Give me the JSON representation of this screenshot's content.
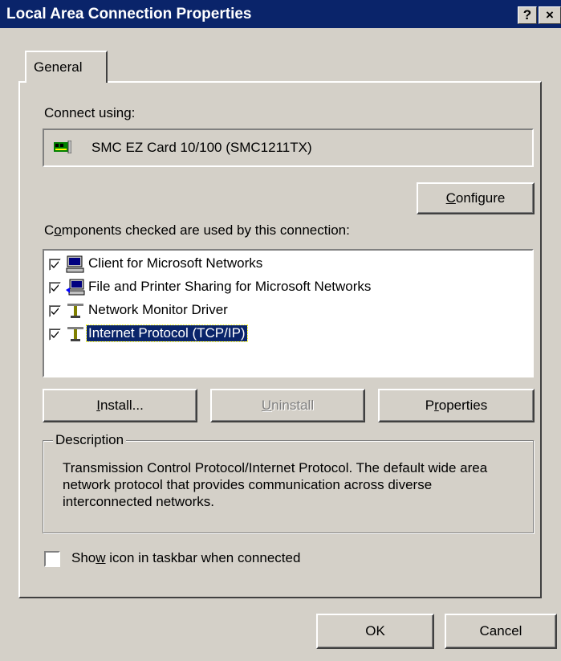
{
  "window": {
    "title": "Local Area Connection Properties",
    "help_button": "?",
    "close_button": "×"
  },
  "tab": {
    "general": "General"
  },
  "connect_using": {
    "label": "Connect using:",
    "adapter_name": "SMC EZ Card 10/100 (SMC1211TX)",
    "adapter_icon": "network-card-icon"
  },
  "configure_button": {
    "label_rest": "onfigure",
    "accesskey": "C"
  },
  "components": {
    "label_pre": "C",
    "label_key": "o",
    "label_rest": "mponents checked are used by this connection:",
    "items": [
      {
        "label": "Client for Microsoft Networks",
        "checked": true,
        "icon": "computer-icon"
      },
      {
        "label": "File and Printer Sharing for Microsoft Networks",
        "checked": true,
        "icon": "printer-sharing-icon"
      },
      {
        "label": "Network Monitor Driver",
        "checked": true,
        "icon": "protocol-icon"
      },
      {
        "label": "Internet Protocol (TCP/IP)",
        "checked": true,
        "icon": "protocol-icon",
        "selected": true
      }
    ]
  },
  "buttons": {
    "install": {
      "key": "I",
      "rest": "nstall..."
    },
    "uninstall": {
      "key": "U",
      "rest": "ninstall"
    },
    "properties": {
      "pre": "P",
      "key": "r",
      "rest": "operties"
    }
  },
  "description": {
    "legend": "Description",
    "text": "Transmission Control Protocol/Internet Protocol. The default wide area network protocol that provides communication across diverse interconnected networks."
  },
  "show_icon": {
    "pre": "Sho",
    "key": "w",
    "rest": " icon in taskbar when connected",
    "checked": false
  },
  "footer": {
    "ok": "OK",
    "cancel": "Cancel"
  },
  "colors": {
    "titlebar": "#0a246a",
    "face": "#d4d0c8",
    "selection": "#0a246a"
  }
}
